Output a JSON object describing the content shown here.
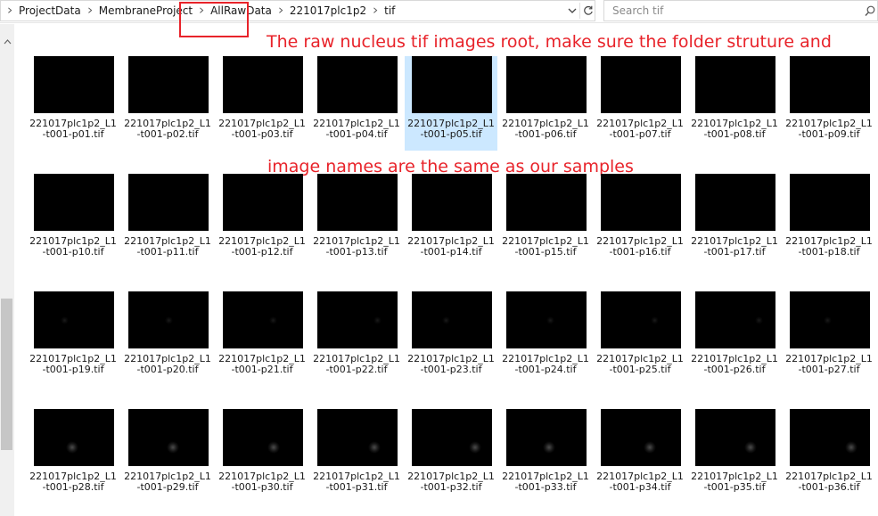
{
  "address": {
    "crumbs": [
      "ProjectData",
      "MembraneProject",
      "AllRawData",
      "221017plc1p2",
      "tif"
    ]
  },
  "search": {
    "placeholder": "Search tif"
  },
  "annotations": [
    "The raw nucleus tif images root, make sure the folder struture and",
    "image names are the same as our samples"
  ],
  "files": [
    {
      "line1": "221017plc1p2_L1",
      "line2": "-t001-p01.tif"
    },
    {
      "line1": "221017plc1p2_L1",
      "line2": "-t001-p02.tif"
    },
    {
      "line1": "221017plc1p2_L1",
      "line2": "-t001-p03.tif"
    },
    {
      "line1": "221017plc1p2_L1",
      "line2": "-t001-p04.tif"
    },
    {
      "line1": "221017plc1p2_L1",
      "line2": "-t001-p05.tif",
      "selected": true
    },
    {
      "line1": "221017plc1p2_L1",
      "line2": "-t001-p06.tif"
    },
    {
      "line1": "221017plc1p2_L1",
      "line2": "-t001-p07.tif"
    },
    {
      "line1": "221017plc1p2_L1",
      "line2": "-t001-p08.tif"
    },
    {
      "line1": "221017plc1p2_L1",
      "line2": "-t001-p09.tif"
    },
    {
      "line1": "221017plc1p2_L1",
      "line2": "-t001-p10.tif"
    },
    {
      "line1": "221017plc1p2_L1",
      "line2": "-t001-p11.tif"
    },
    {
      "line1": "221017plc1p2_L1",
      "line2": "-t001-p12.tif"
    },
    {
      "line1": "221017plc1p2_L1",
      "line2": "-t001-p13.tif"
    },
    {
      "line1": "221017plc1p2_L1",
      "line2": "-t001-p14.tif"
    },
    {
      "line1": "221017plc1p2_L1",
      "line2": "-t001-p15.tif"
    },
    {
      "line1": "221017plc1p2_L1",
      "line2": "-t001-p16.tif"
    },
    {
      "line1": "221017plc1p2_L1",
      "line2": "-t001-p17.tif"
    },
    {
      "line1": "221017plc1p2_L1",
      "line2": "-t001-p18.tif"
    },
    {
      "line1": "221017plc1p2_L1",
      "line2": "-t001-p19.tif"
    },
    {
      "line1": "221017plc1p2_L1",
      "line2": "-t001-p20.tif"
    },
    {
      "line1": "221017plc1p2_L1",
      "line2": "-t001-p21.tif"
    },
    {
      "line1": "221017plc1p2_L1",
      "line2": "-t001-p22.tif"
    },
    {
      "line1": "221017plc1p2_L1",
      "line2": "-t001-p23.tif"
    },
    {
      "line1": "221017plc1p2_L1",
      "line2": "-t001-p24.tif"
    },
    {
      "line1": "221017plc1p2_L1",
      "line2": "-t001-p25.tif"
    },
    {
      "line1": "221017plc1p2_L1",
      "line2": "-t001-p26.tif"
    },
    {
      "line1": "221017plc1p2_L1",
      "line2": "-t001-p27.tif"
    },
    {
      "line1": "221017plc1p2_L1",
      "line2": "-t001-p28.tif"
    },
    {
      "line1": "221017plc1p2_L1",
      "line2": "-t001-p29.tif"
    },
    {
      "line1": "221017plc1p2_L1",
      "line2": "-t001-p30.tif"
    },
    {
      "line1": "221017plc1p2_L1",
      "line2": "-t001-p31.tif"
    },
    {
      "line1": "221017plc1p2_L1",
      "line2": "-t001-p32.tif"
    },
    {
      "line1": "221017plc1p2_L1",
      "line2": "-t001-p33.tif"
    },
    {
      "line1": "221017plc1p2_L1",
      "line2": "-t001-p34.tif"
    },
    {
      "line1": "221017plc1p2_L1",
      "line2": "-t001-p35.tif"
    },
    {
      "line1": "221017plc1p2_L1",
      "line2": "-t001-p36.tif"
    }
  ],
  "colors": {
    "annotation": "#e8232a",
    "selection": "#cce8ff",
    "thumbnail": "#000000"
  },
  "icons": {
    "crumb_separator": "chevron-right-icon",
    "address_dropdown": "chevron-down-icon",
    "refresh": "refresh-icon",
    "search": "search-icon",
    "scroll_up": "chevron-up-icon"
  }
}
